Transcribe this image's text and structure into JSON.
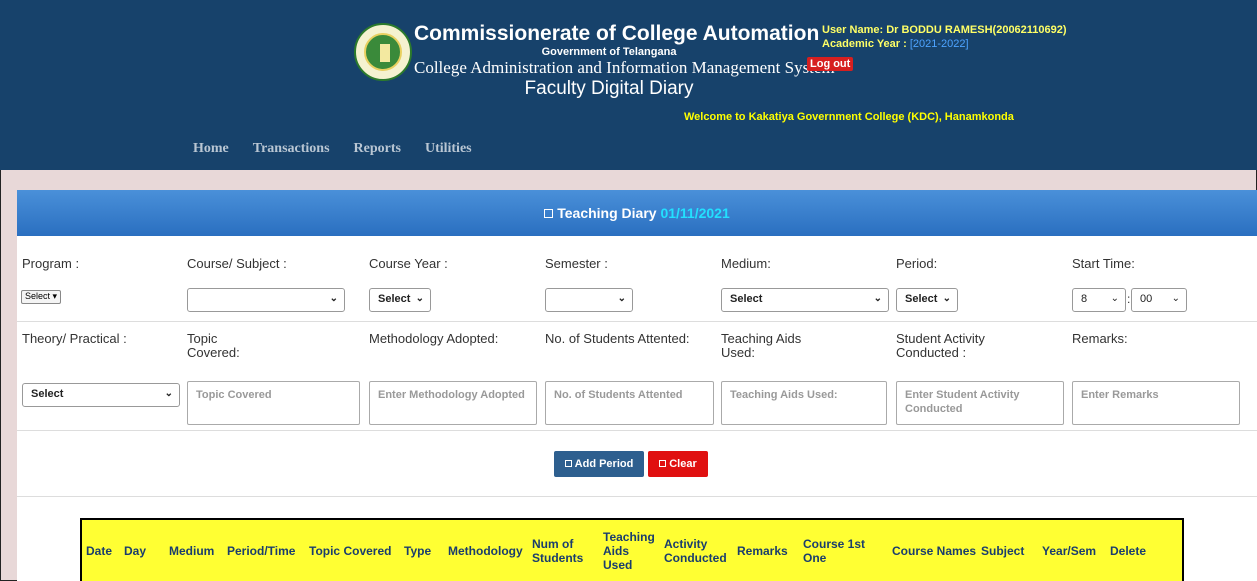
{
  "header": {
    "title": "Commissionerate of College Automation",
    "gov": "Government of Telangana",
    "system": "College Administration and Information Management System",
    "module": "Faculty Digital Diary",
    "logout": "Log out",
    "user_label": "User Name:",
    "user_name": "Dr BODDU RAMESH(20062110692)",
    "year_label": "Academic Year :",
    "year_value": "[2021-2022]",
    "welcome_label": "Welcome to",
    "college": "Kakatiya Government College (KDC), Hanamkonda"
  },
  "nav": [
    "Home",
    "Transactions",
    "Reports",
    "Utilities"
  ],
  "panel": {
    "title": "Teaching Diary",
    "date": "01/11/2021"
  },
  "row1": {
    "labels": [
      "Program :",
      "Course/ Subject :",
      "Course Year :",
      "Semester :",
      "Medium:",
      "Period:",
      "Start Time:"
    ],
    "program_value": "Select",
    "course_year_value": "Select",
    "medium_value": "Select",
    "period_value": "Select",
    "hour": "8",
    "minute": "00"
  },
  "row2": {
    "labels": [
      "Theory/ Practical :",
      "Topic Covered:",
      "Methodology Adopted:",
      "No. of Students Attented:",
      "Teaching Aids Used:",
      "Student Activity Conducted :",
      "Remarks:"
    ],
    "theory_value": "Select",
    "placeholders": [
      "Topic Covered",
      "Enter Methodology Adopted",
      "No. of Students Attented",
      "Teaching Aids Used:",
      "Enter Student Activity Conducted",
      "Enter Remarks"
    ]
  },
  "buttons": {
    "add": "Add Period",
    "clear": "Clear"
  },
  "colors": {
    "header": "#17426b",
    "add": "#2e5f8f",
    "clear": "#e01010",
    "table_head": "#ffff33"
  },
  "table_headers": [
    "Date",
    "Day",
    "Medium",
    "Period/Time",
    "Topic Covered",
    "Type",
    "Methodology",
    "Num of Students",
    "Teaching Aids Used",
    "Activity Conducted",
    "Remarks",
    "Course 1st One",
    "Course Names",
    "Subject",
    "Year/Sem",
    "Delete"
  ]
}
